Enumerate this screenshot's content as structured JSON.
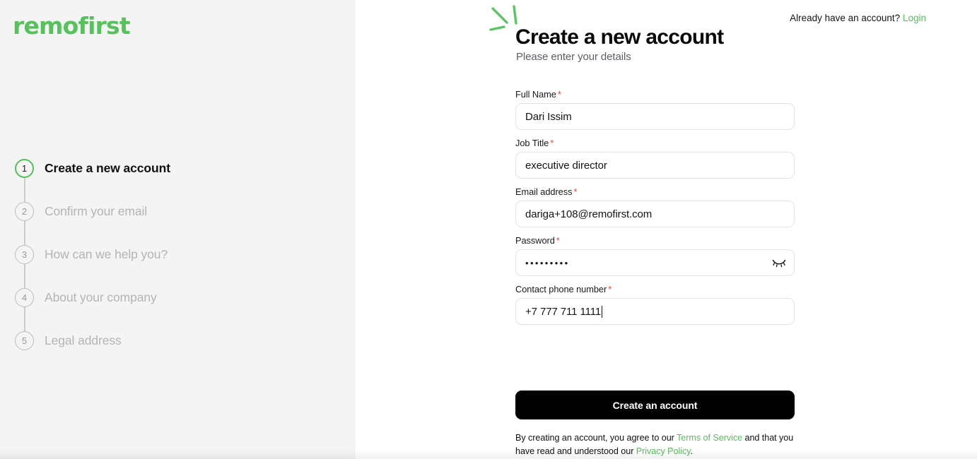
{
  "brand": {
    "logo_text": "remofirst",
    "green": "#55c05b",
    "black": "#0a0a0a",
    "required_red": "#f0412a"
  },
  "sidebar": {
    "steps": [
      {
        "number": "1",
        "label": "Create a new account",
        "state": "active"
      },
      {
        "number": "2",
        "label": "Confirm your email",
        "state": "upcoming"
      },
      {
        "number": "3",
        "label": "How can we help you?",
        "state": "upcoming"
      },
      {
        "number": "4",
        "label": "About your company",
        "state": "upcoming"
      },
      {
        "number": "5",
        "label": "Legal address",
        "state": "upcoming"
      }
    ]
  },
  "topbar": {
    "prompt": "Already have an account?",
    "login_label": "Login"
  },
  "header": {
    "title": "Create a new account",
    "subtitle": "Please enter your details",
    "decoration_icon": "sparkle-icon"
  },
  "form": {
    "fields": [
      {
        "name": "full-name",
        "label": "Full Name",
        "required_mark": "*",
        "value": "Dari Issim",
        "placeholder": "Full Name"
      },
      {
        "name": "job-title",
        "label": "Job Title",
        "required_mark": "*",
        "value": "executive director",
        "placeholder": "Job Title"
      },
      {
        "name": "email",
        "label": "Email address",
        "required_mark": "*",
        "value": "dariga+108@remofirst.com",
        "placeholder": "Email address"
      },
      {
        "name": "password",
        "label": "Password",
        "required_mark": "*",
        "value": "•••••••••",
        "placeholder": "Password",
        "toggle_icon": "eye-off-icon"
      },
      {
        "name": "contact-phone-number",
        "label": "Contact phone number",
        "required_mark": "*",
        "value": "+7 777 711 1111",
        "placeholder": "Contact phone number",
        "focused": true
      }
    ],
    "submit_label": "Create an account"
  },
  "legal": {
    "part1": "By creating an account, you agree to our ",
    "terms_label": "Terms of Service",
    "part2": " and that you have read and understood our ",
    "privacy_label": "Privacy Policy",
    "part3": "."
  }
}
